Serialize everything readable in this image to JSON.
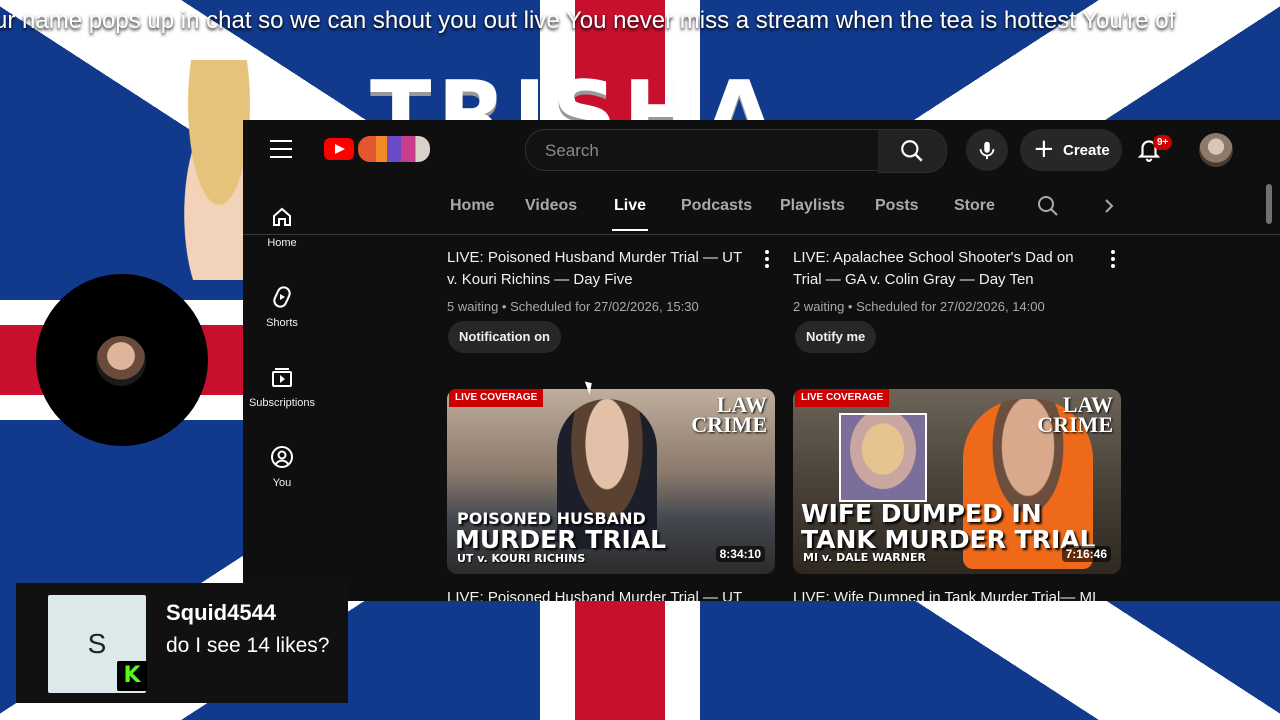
{
  "ticker": {
    "text": "ur name pops up in chat so we can shout you out live You never miss a stream when the tea is hottest You're of"
  },
  "background": {
    "title_text": "TRISHA"
  },
  "youtube": {
    "search": {
      "placeholder": "Search"
    },
    "create_label": "Create",
    "notifications_badge": "9+",
    "sidebar": [
      {
        "label": "Home",
        "icon": "home-icon"
      },
      {
        "label": "Shorts",
        "icon": "shorts-icon"
      },
      {
        "label": "Subscriptions",
        "icon": "subscriptions-icon"
      },
      {
        "label": "You",
        "icon": "you-icon"
      }
    ],
    "tabs": [
      "Home",
      "Videos",
      "Live",
      "Podcasts",
      "Playlists",
      "Posts",
      "Store"
    ],
    "active_tab": "Live",
    "upcoming": [
      {
        "title": "LIVE: Poisoned Husband Murder Trial — UT v. Kouri Richins — Day Five",
        "meta": "5 waiting • Scheduled for 27/02/2026, 15:30",
        "button": "Notification on"
      },
      {
        "title": "LIVE: Apalachee School Shooter's Dad on Trial — GA v. Colin Gray — Day Ten",
        "meta": "2 waiting • Scheduled for 27/02/2026, 14:00",
        "button": "Notify me"
      }
    ],
    "videos": [
      {
        "badge": "LIVE COVERAGE",
        "brand_top": "LAW",
        "brand_bottom": "CRIME",
        "caption_line1": "POISONED HUSBAND",
        "caption_line2": "MURDER TRIAL",
        "caption_line3": "UT v. KOURI RICHINS",
        "duration": "8:34:10",
        "title": "LIVE: Poisoned Husband Murder Trial — UT"
      },
      {
        "badge": "LIVE COVERAGE",
        "brand_top": "LAW",
        "brand_bottom": "CRIME",
        "caption_line1": "WIFE DUMPED IN",
        "caption_line2": "TANK MURDER TRIAL",
        "caption_line3": "MI v. DALE WARNER",
        "duration": "7:16:46",
        "title": "LIVE: Wife Dumped in Tank Murder Trial— MI"
      }
    ]
  },
  "chat": {
    "avatar_letter": "S",
    "badge_letter": "K",
    "username": "Squid4544",
    "message": "do I see 14 likes?"
  },
  "colors": {
    "brand_red": "#ff0000",
    "live_badge": "#cc0000",
    "kick_green": "#53fc18"
  }
}
